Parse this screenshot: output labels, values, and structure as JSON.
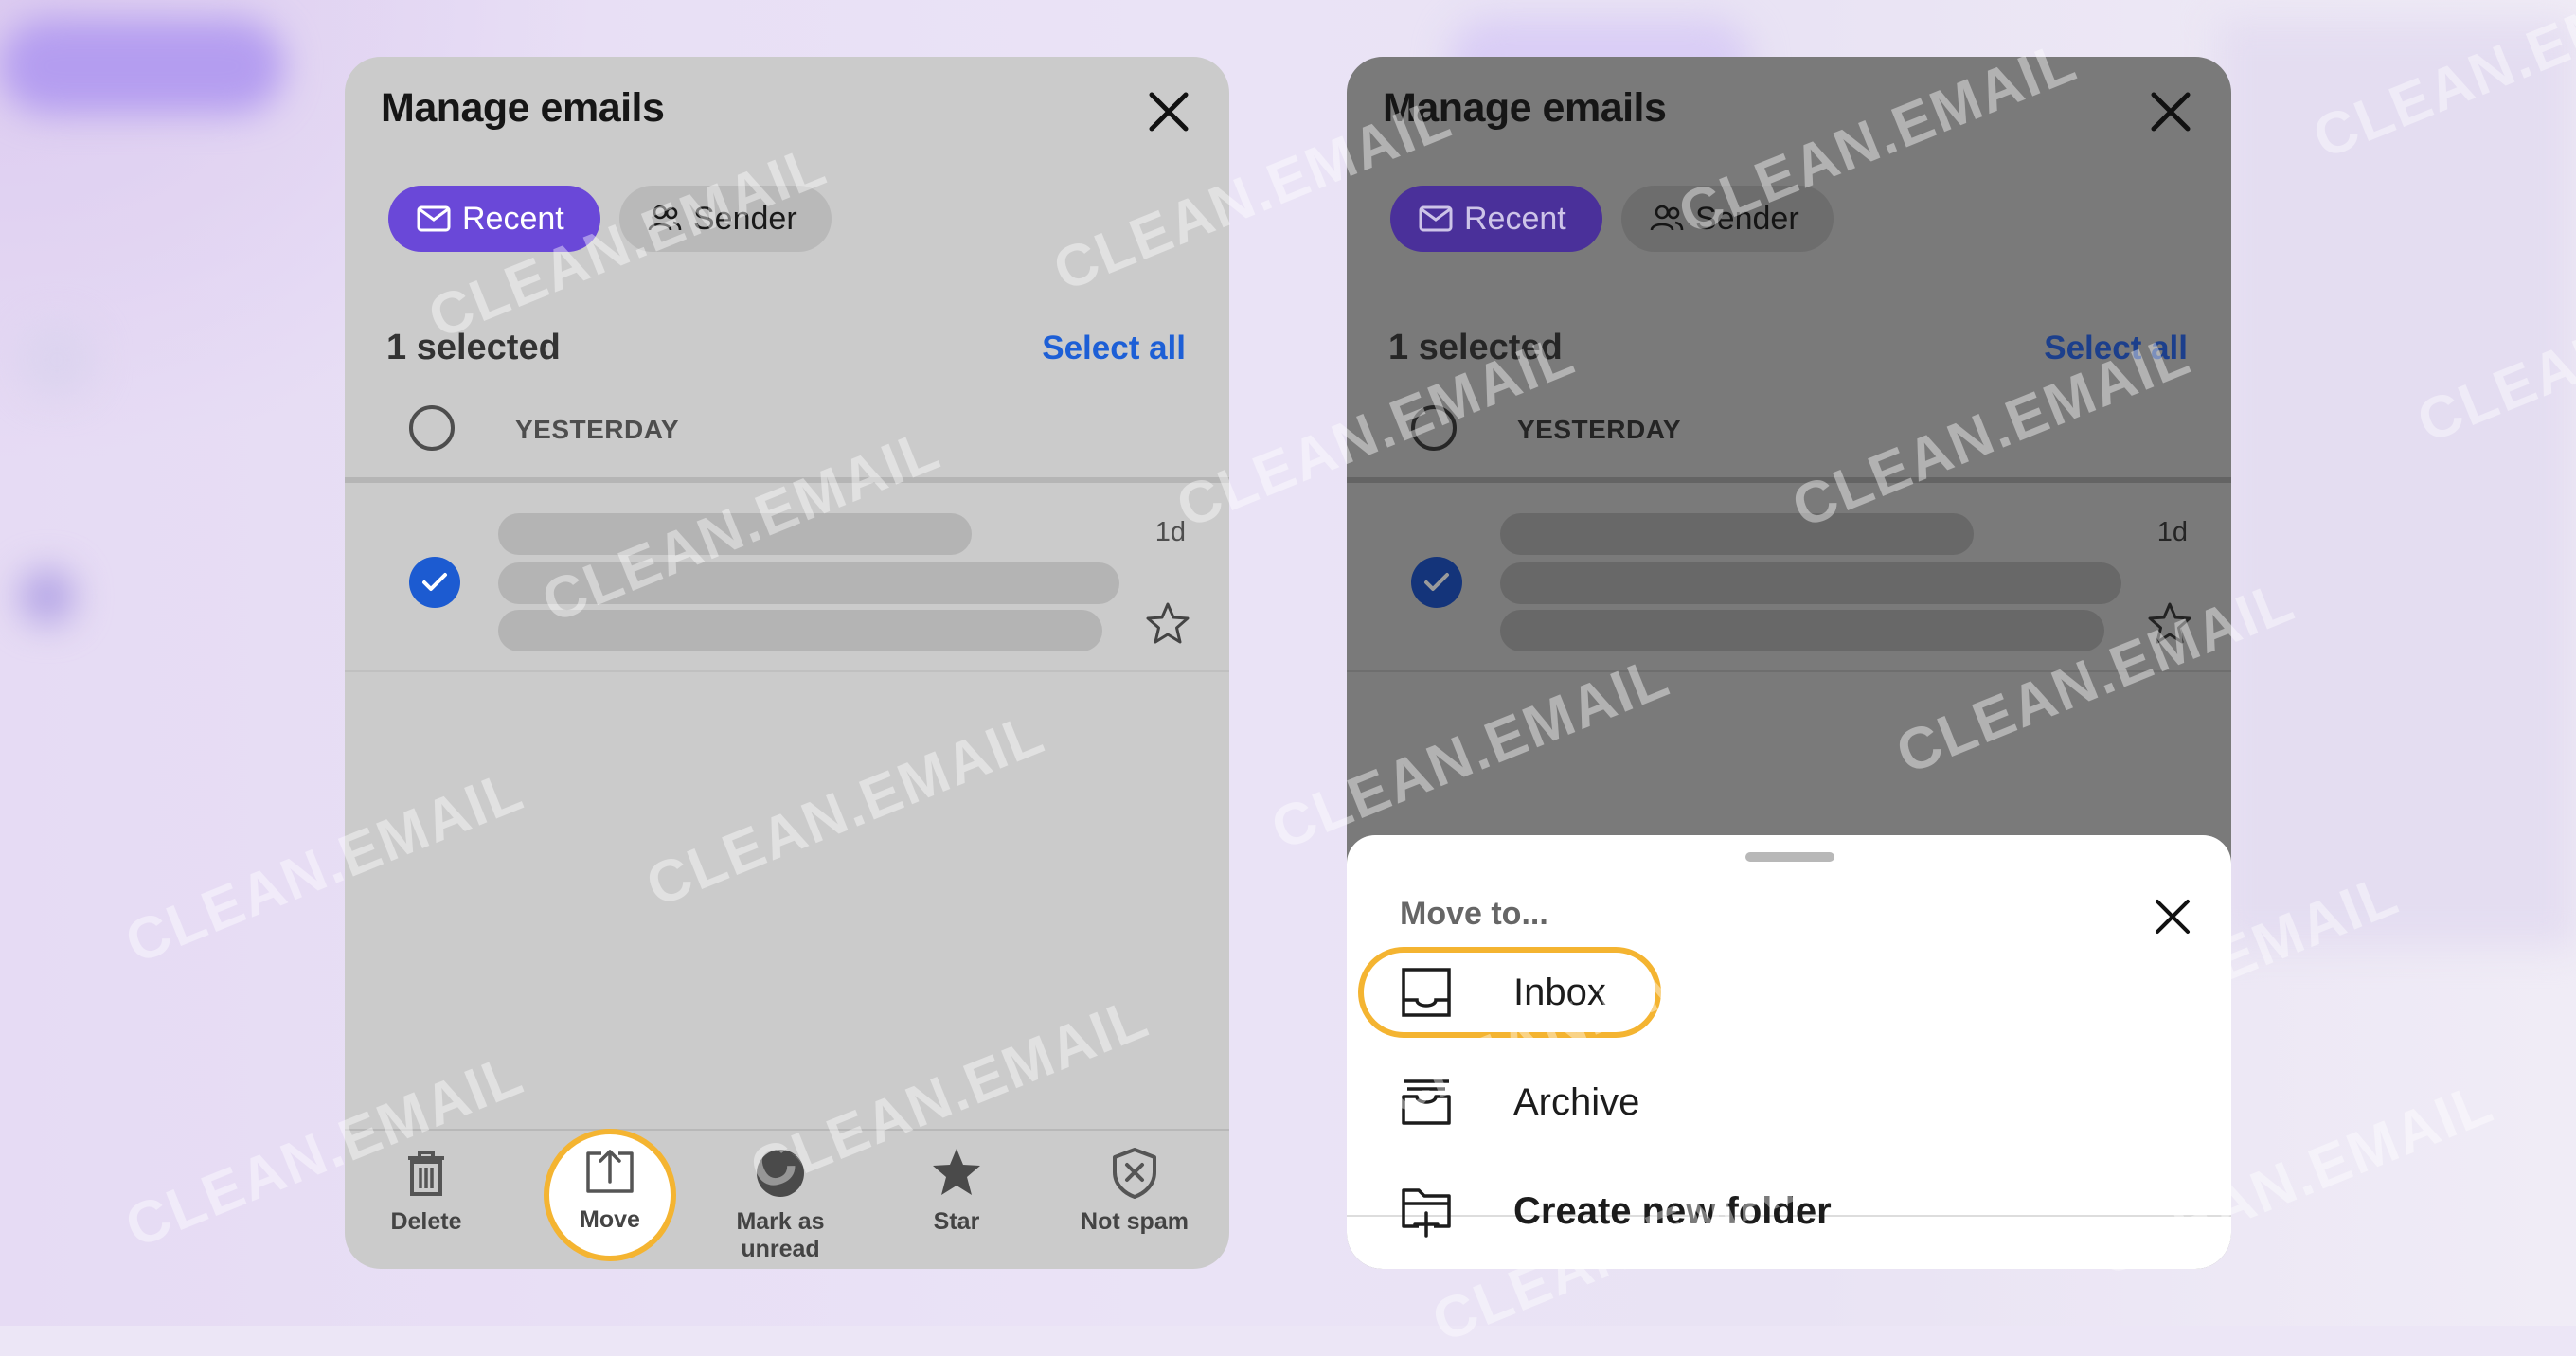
{
  "left_screen": {
    "title": "Manage emails",
    "tabs": [
      {
        "label": "Recent",
        "icon": "envelope-icon",
        "active": true
      },
      {
        "label": "Sender",
        "icon": "people-icon",
        "active": false
      }
    ],
    "selected_count": "1 selected",
    "select_all": "Select all",
    "group_label": "YESTERDAY",
    "email": {
      "age": "1d",
      "checked": true
    },
    "toolbar": [
      {
        "label": "Delete",
        "icon": "trash-icon"
      },
      {
        "label": "Move",
        "icon": "move-icon",
        "highlighted": true
      },
      {
        "label": "Mark as unread",
        "icon": "unread-icon"
      },
      {
        "label": "Star",
        "icon": "star-icon"
      },
      {
        "label": "Not spam",
        "icon": "not-spam-icon"
      }
    ]
  },
  "right_screen": {
    "title": "Manage emails",
    "tabs": [
      {
        "label": "Recent",
        "icon": "envelope-icon",
        "active": true
      },
      {
        "label": "Sender",
        "icon": "people-icon",
        "active": false
      }
    ],
    "selected_count": "1 selected",
    "select_all": "Select all",
    "group_label": "YESTERDAY",
    "email": {
      "age": "1d",
      "checked": true
    },
    "move_sheet": {
      "title": "Move to...",
      "items": [
        {
          "label": "Inbox",
          "icon": "inbox-tray-icon",
          "highlighted": true
        },
        {
          "label": "Archive",
          "icon": "archive-box-icon"
        },
        {
          "label": "Create new folder",
          "icon": "add-folder-icon"
        }
      ]
    }
  },
  "watermark": "CLEAN.EMAIL",
  "colors": {
    "accent_purple": "#6a48d8",
    "link_blue": "#1d5fd6",
    "highlight_ring": "#f4b431",
    "check_blue": "#1c5bd1"
  }
}
